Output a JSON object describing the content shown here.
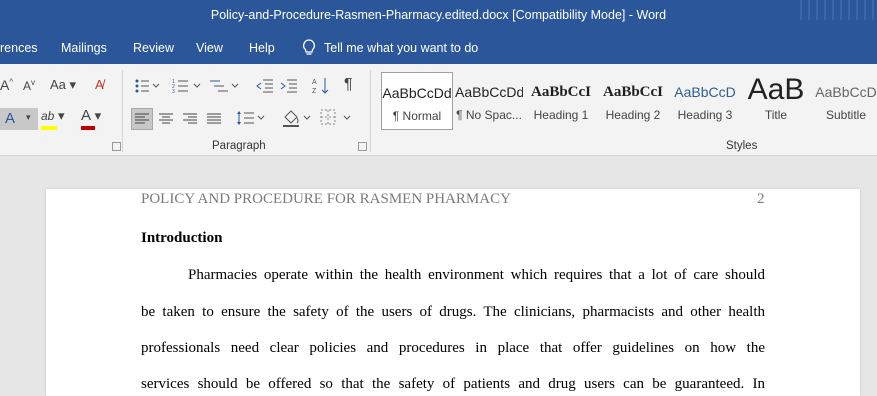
{
  "window": {
    "title": "Policy-and-Procedure-Rasmen-Pharmacy.edited.docx [Compatibility Mode]  -  Word"
  },
  "ribbon_tabs": [
    {
      "label": "rences"
    },
    {
      "label": "Mailings"
    },
    {
      "label": "Review"
    },
    {
      "label": "View"
    },
    {
      "label": "Help"
    }
  ],
  "tell_me": {
    "placeholder": "Tell me what you want to do"
  },
  "ribbon": {
    "font_group": {
      "grow": "A",
      "shrink": "A",
      "change_case": "Aa",
      "effects": "A",
      "highlight": "ab",
      "font_color": "A"
    },
    "paragraph_group": {
      "label": "Paragraph",
      "pilcrow": "¶"
    },
    "styles_group": {
      "label": "Styles"
    },
    "styles": [
      {
        "preview": "AaBbCcDd",
        "name": "¶ Normal",
        "selected": true
      },
      {
        "preview": "AaBbCcDd",
        "name": "¶ No Spac..."
      },
      {
        "preview": "AaBbCcI",
        "name": "Heading 1"
      },
      {
        "preview": "AaBbCcI",
        "name": "Heading 2"
      },
      {
        "preview": "AaBbCcD",
        "name": "Heading 3"
      },
      {
        "preview": "AaB",
        "name": "Title"
      },
      {
        "preview": "AaBbCcD",
        "name": "Subtitle"
      }
    ]
  },
  "document": {
    "header_text": "POLICY AND PROCEDURE FOR RASMEN PHARMACY",
    "page_number": "2",
    "heading": "Introduction",
    "lines": [
      "Pharmacies operate within the health environment which requires that a lot of care should",
      "be taken to ensure the safety of the users of drugs. The clinicians, pharmacists and other health",
      "professionals need clear policies and procedures in place that offer guidelines on how the",
      "services should be offered so that the safety of patients and drug users can be guaranteed. In"
    ]
  },
  "colors": {
    "brand": "#2b579a",
    "ribbon": "#f3f3f3",
    "canvas": "#e6e6e6",
    "font_color_red": "#c00000",
    "highlight_yellow": "#ffff00"
  },
  "icons": [
    "lightbulb-icon",
    "bullets-icon",
    "numbering-icon",
    "multilevel-icon",
    "decrease-indent-icon",
    "increase-indent-icon",
    "sort-icon",
    "show-formatting-icon",
    "align-left-icon",
    "align-center-icon",
    "align-right-icon",
    "justify-icon",
    "line-spacing-icon",
    "shading-icon",
    "borders-icon",
    "clear-formatting-icon"
  ]
}
